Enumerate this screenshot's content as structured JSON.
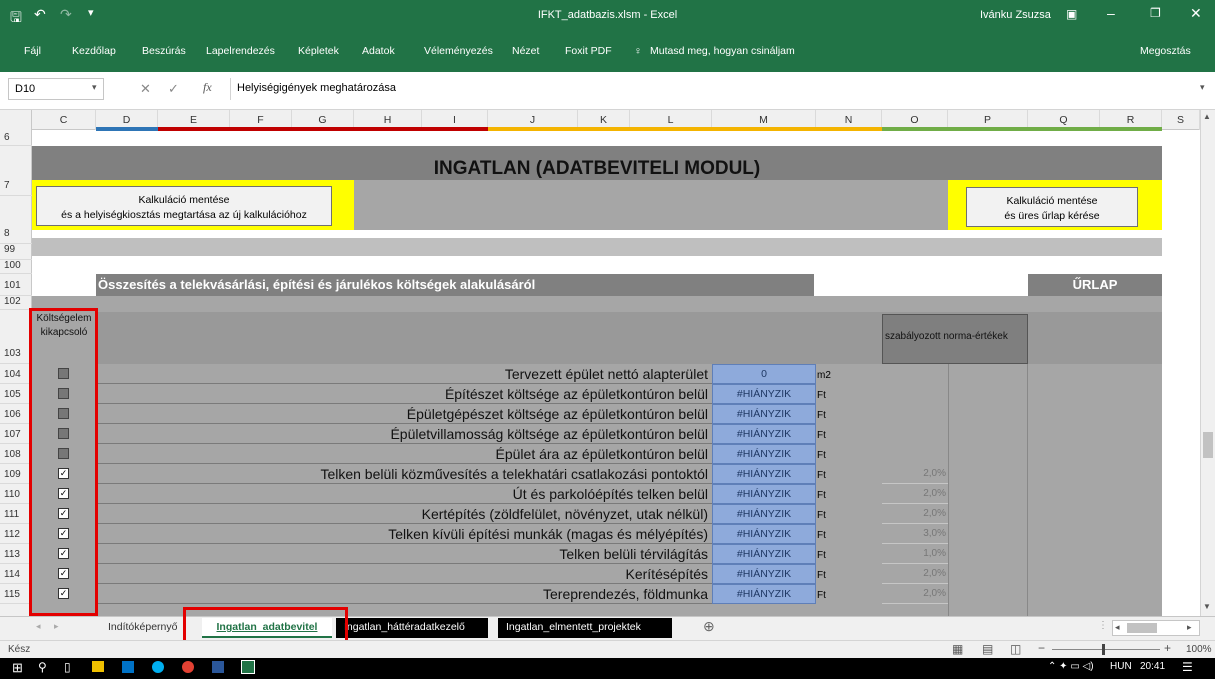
{
  "window": {
    "title": "IFKT_adatbazis.xlsm - Excel",
    "user": "Ivánku Zsuzsa"
  },
  "ribbon": {
    "tabs": [
      "Fájl",
      "Kezdőlap",
      "Beszúrás",
      "Lapelrendezés",
      "Képletek",
      "Adatok",
      "Véleményezés",
      "Nézet",
      "Foxit PDF"
    ],
    "tell_me": "Mutasd meg, hogyan csináljam",
    "share": "Megosztás"
  },
  "formula": {
    "namebox": "D10",
    "content": "Helyiségigények meghatározása",
    "fx": "fx"
  },
  "columns": [
    "C",
    "D",
    "E",
    "F",
    "G",
    "H",
    "I",
    "J",
    "K",
    "L",
    "M",
    "N",
    "O",
    "P",
    "Q",
    "R",
    "S"
  ],
  "rownums": {
    "r6": "6",
    "r7": "7",
    "r8": "8",
    "r99": "99",
    "r100": "100",
    "r101": "101",
    "r102": "102",
    "r103": "103"
  },
  "sheet": {
    "title": "INGATLAN (ADATBEVITELI MODUL)",
    "btn_left": "Kalkuláció mentése\nés a helyiségkiosztás megtartása az új kalkulációhoz",
    "btn_right": "Kalkuláció mentése\nés üres űrlap kérése",
    "section_title": "Összesítés a telekvásárlási, építési és járulékos költségek alakulásáról",
    "urlap": "ŰRLAP",
    "toggle_header": "Költségelem kikapcsoló",
    "norm_header": "szabályozott norma-értékek",
    "rows": [
      {
        "n": "104",
        "label": "Tervezett épület nettó alapterület",
        "value": "0",
        "unit": "m2",
        "pct": "",
        "checked": false,
        "disabled": true
      },
      {
        "n": "105",
        "label": "Építészet költsége az épületkontúron belül",
        "value": "#HIÁNYZIK",
        "unit": "Ft",
        "pct": "",
        "checked": false,
        "disabled": true
      },
      {
        "n": "106",
        "label": "Épületgépészet költsége az épületkontúron belül",
        "value": "#HIÁNYZIK",
        "unit": "Ft",
        "pct": "",
        "checked": false,
        "disabled": true
      },
      {
        "n": "107",
        "label": "Épületvillamosság költsége az épületkontúron belül",
        "value": "#HIÁNYZIK",
        "unit": "Ft",
        "pct": "",
        "checked": false,
        "disabled": true
      },
      {
        "n": "108",
        "label": "Épület ára az épületkontúron belül",
        "value": "#HIÁNYZIK",
        "unit": "Ft",
        "pct": "",
        "checked": false,
        "disabled": true
      },
      {
        "n": "109",
        "label": "Telken belüli közművesítés a telekhatári csatlakozási pontoktól",
        "value": "#HIÁNYZIK",
        "unit": "Ft",
        "pct": "2,0%",
        "checked": true,
        "disabled": false
      },
      {
        "n": "110",
        "label": "Út és parkolóépítés telken belül",
        "value": "#HIÁNYZIK",
        "unit": "Ft",
        "pct": "2,0%",
        "checked": true,
        "disabled": false
      },
      {
        "n": "111",
        "label": "Kertépítés (zöldfelület, növényzet, utak nélkül)",
        "value": "#HIÁNYZIK",
        "unit": "Ft",
        "pct": "2,0%",
        "checked": true,
        "disabled": false
      },
      {
        "n": "112",
        "label": "Telken kívüli építési munkák (magas és mélyépítés)",
        "value": "#HIÁNYZIK",
        "unit": "Ft",
        "pct": "3,0%",
        "checked": true,
        "disabled": false
      },
      {
        "n": "113",
        "label": "Telken belüli térvilágítás",
        "value": "#HIÁNYZIK",
        "unit": "Ft",
        "pct": "1,0%",
        "checked": true,
        "disabled": false
      },
      {
        "n": "114",
        "label": "Kerítésépítés",
        "value": "#HIÁNYZIK",
        "unit": "Ft",
        "pct": "2,0%",
        "checked": true,
        "disabled": false
      },
      {
        "n": "115",
        "label": "Tereprendezés, földmunka",
        "value": "#HIÁNYZIK",
        "unit": "Ft",
        "pct": "2,0%",
        "checked": true,
        "disabled": false
      }
    ]
  },
  "tabs": {
    "t1": "Indítóképernyő",
    "t2": "Ingatlan_adatbevitel",
    "t3": "Ingatlan_háttéradatkezelő",
    "t4": "Ingatlan_elmentett_projektek"
  },
  "status": {
    "ready": "Kész",
    "zoom": "100%"
  },
  "taskbar": {
    "lang": "HUN",
    "time": "20:41"
  }
}
